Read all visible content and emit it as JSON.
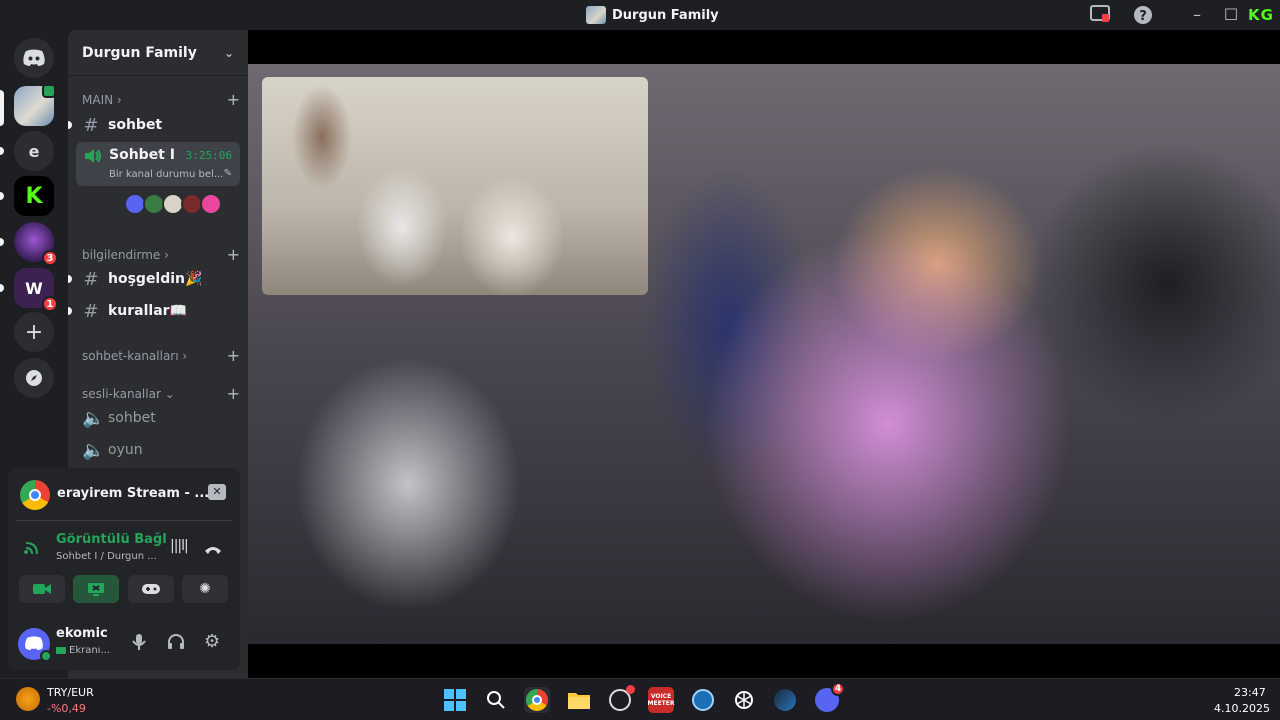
{
  "window": {
    "title": "Durgun Family"
  },
  "rail": {
    "servers": [
      {
        "name": "discord-home",
        "letter": ""
      },
      {
        "name": "durgun-family",
        "letter": ""
      },
      {
        "name": "server-e",
        "letter": "e"
      },
      {
        "name": "kick",
        "letter": "K"
      },
      {
        "name": "server-purple",
        "letter": "",
        "badge": "3"
      },
      {
        "name": "server-lw",
        "letter": "",
        "badge": "1"
      }
    ]
  },
  "sidebar": {
    "server_name": "Durgun Family",
    "categories": {
      "main": "MAIN",
      "info": "bilgilendirme",
      "chat": "sohbet-kanalları",
      "voice": "sesli-kanallar"
    },
    "channels": {
      "sohbet_text": "sohbet",
      "active_voice": "Sohbet I",
      "active_timer": "3:25:06",
      "active_status": "Bir kanal durumu bel...",
      "hosgeldin": "hoşgeldin🎉",
      "kurallar": "kurallar📖",
      "voice_sohbet": "sohbet",
      "voice_oyun": "oyun"
    }
  },
  "panel": {
    "stream_title": "erayirem Stream - ...",
    "connection_status": "Görüntülü Bağl",
    "connection_sub": "Sohbet I / Durgun ...",
    "user_name": "ekomic",
    "user_status": "Ekranı..."
  },
  "taskbar": {
    "widget_title": "TRY/EUR",
    "widget_value": "-%0,49",
    "time": "23:47",
    "date": "4.10.2025",
    "discord_badge": "4",
    "voicemeeter_label": "VOICE MEETER"
  },
  "colors": {
    "accent_green": "#23a55a",
    "badge_red": "#f23f43",
    "blurple": "#5865f2",
    "kick_green": "#53fc18"
  }
}
